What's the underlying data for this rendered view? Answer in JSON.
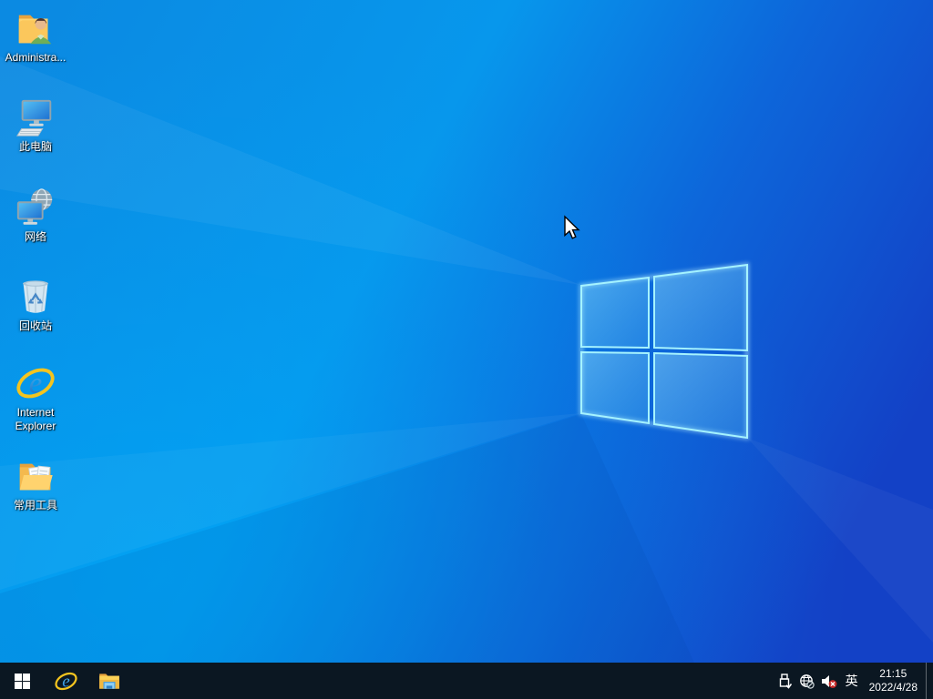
{
  "wallpaper": {
    "base_left_color": "#0b8ae2",
    "base_right_color": "#1341c6",
    "bottom_left_glow": "#00a7f6",
    "logo_edge_color": "#a5f3ff",
    "logo_pane_color": "#7fd0f7"
  },
  "desktop": {
    "icons": [
      {
        "id": "administrator",
        "label": "Administra..."
      },
      {
        "id": "this-pc",
        "label": "此电脑"
      },
      {
        "id": "network",
        "label": "网络"
      },
      {
        "id": "recycle-bin",
        "label": "回收站"
      },
      {
        "id": "internet-explorer",
        "label": "Internet Explorer"
      },
      {
        "id": "common-tools",
        "label": "常用工具"
      }
    ]
  },
  "taskbar": {
    "background_color": "#0b1722",
    "buttons": [
      {
        "id": "start",
        "icon": "windows-logo-icon"
      },
      {
        "id": "internet-explorer",
        "icon": "ie-icon"
      },
      {
        "id": "file-explorer",
        "icon": "folder-icon"
      }
    ],
    "tray": {
      "icons": [
        "usb-device-icon",
        "network-disconnected-icon",
        "volume-muted-icon"
      ],
      "input_indicator": "英",
      "clock": {
        "time": "21:15",
        "date": "2022/4/28"
      }
    }
  }
}
